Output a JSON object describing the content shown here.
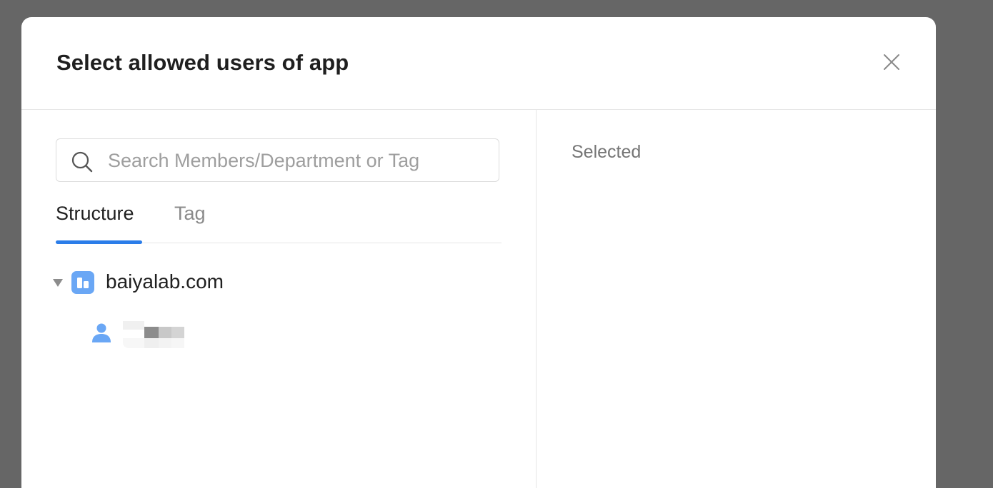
{
  "dialog": {
    "title": "Select allowed users of app",
    "close_icon": "close-icon"
  },
  "search": {
    "placeholder": "Search Members/Department or Tag",
    "value": "",
    "icon": "search-icon"
  },
  "tabs": [
    {
      "label": "Structure",
      "active": true
    },
    {
      "label": "Tag",
      "active": false
    }
  ],
  "tree": {
    "org": {
      "label": "baiyalab.com",
      "icon": "building-icon",
      "expanded": true
    },
    "members": [
      {
        "icon": "user-icon",
        "name_obscured": true
      }
    ]
  },
  "selected_panel": {
    "label": "Selected"
  },
  "colors": {
    "accent": "#2b7de9",
    "icon_blue": "#6aa7f5",
    "backdrop": "#666666"
  }
}
